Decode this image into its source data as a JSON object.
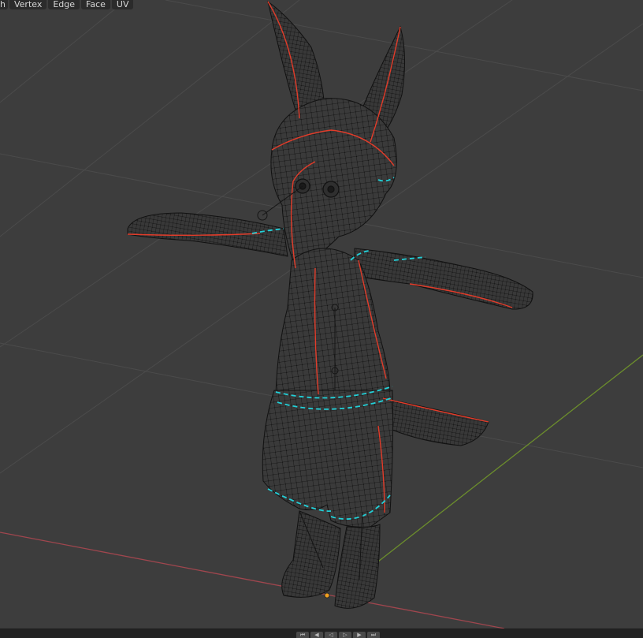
{
  "header": {
    "menu": [
      {
        "id": "mesh",
        "label": "h"
      },
      {
        "id": "vertex",
        "label": "Vertex"
      },
      {
        "id": "edge",
        "label": "Edge"
      },
      {
        "id": "face",
        "label": "Face"
      },
      {
        "id": "uv",
        "label": "UV"
      }
    ]
  },
  "viewport": {
    "background": "#3d3d3d",
    "grid_color": "#4b4b4b",
    "x_axis_color": "#a0464e",
    "y_axis_color": "#6c8e2c",
    "wire_color": "#111111",
    "seam_color": "#e23c2a",
    "sharp_color": "#22d0d8",
    "origin_color": "#f0a020",
    "model": "fox-character-wireframe"
  },
  "footer": {
    "buttons": [
      {
        "id": "jump-start",
        "label": "⏮"
      },
      {
        "id": "prev-key",
        "label": "◀"
      },
      {
        "id": "play-reverse",
        "label": "◁"
      },
      {
        "id": "play",
        "label": "▷"
      },
      {
        "id": "next-key",
        "label": "▶"
      },
      {
        "id": "jump-end",
        "label": "⏭"
      }
    ]
  }
}
